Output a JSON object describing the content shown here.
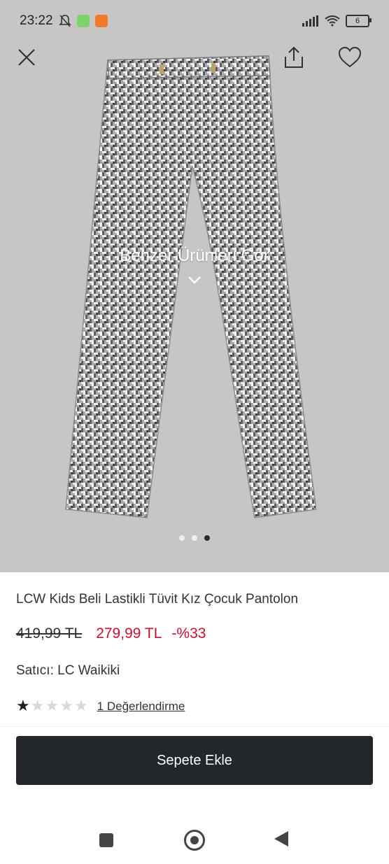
{
  "status": {
    "time": "23:22",
    "battery": "6"
  },
  "product": {
    "title": "LCW Kids Beli Lastikli Tüvit Kız Çocuk Pantolon",
    "old_price": "419,99 TL",
    "new_price": "279,99 TL",
    "discount": "-%33",
    "seller": "Satıcı: LC Waikiki",
    "rating_filled_stars": 1,
    "rating_total_stars": 5,
    "rating_link": "1 Değerlendirme"
  },
  "gallery": {
    "similar_label": "Benzer Ürünleri Gör",
    "image_count": 3,
    "active_index": 2
  },
  "actions": {
    "add_to_cart": "Sepete Ekle"
  },
  "colors": {
    "price_red": "#c8102e",
    "button_dark": "#23262a",
    "image_bg": "#c7c6c5"
  },
  "icons": [
    "close-icon",
    "share-icon",
    "heart-icon",
    "chevron-down-icon",
    "star-icon"
  ]
}
